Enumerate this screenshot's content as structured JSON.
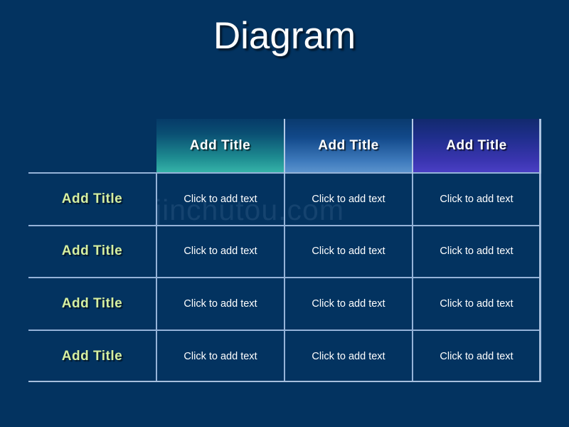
{
  "slide": {
    "title": "Diagram",
    "background_color": "#033360",
    "watermark": "jinchutou.com"
  },
  "colors": {
    "background": "#033360",
    "title_text": "#ffffff",
    "grid_line": "#a7bfdd",
    "row_label_text": "#d6efa0",
    "cell_text": "#ffffff",
    "header_gradient_1_top": "#063b68",
    "header_gradient_1_bottom": "#35b3a8",
    "header_gradient_2_top": "#0a3a6e",
    "header_gradient_2_bottom": "#5b93cd",
    "header_gradient_3_top": "#122a6e",
    "header_gradient_3_bottom": "#4a3fc4"
  },
  "table": {
    "corner_label": "",
    "column_headers": [
      "Add Title",
      "Add Title",
      "Add Title"
    ],
    "rows": [
      {
        "label": "Add Title",
        "cells": [
          "Click to add text",
          "Click to add text",
          "Click to add text"
        ]
      },
      {
        "label": "Add Title",
        "cells": [
          "Click to add text",
          "Click to add text",
          "Click to add text"
        ]
      },
      {
        "label": "Add Title",
        "cells": [
          "Click to add text",
          "Click to add text",
          "Click to add text"
        ]
      },
      {
        "label": "Add Title",
        "cells": [
          "Click to add text",
          "Click to add text",
          "Click to add text"
        ]
      }
    ]
  }
}
